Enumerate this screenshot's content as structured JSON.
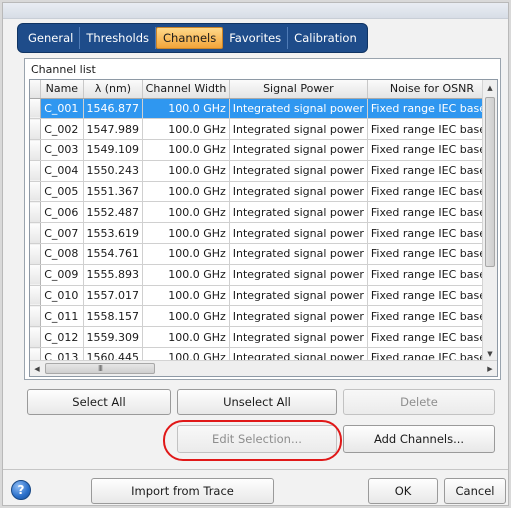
{
  "tabs": [
    {
      "label": "General",
      "active": false
    },
    {
      "label": "Thresholds",
      "active": false
    },
    {
      "label": "Channels",
      "active": true
    },
    {
      "label": "Favorites",
      "active": false
    },
    {
      "label": "Calibration",
      "active": false
    }
  ],
  "channel_list": {
    "title": "Channel list",
    "columns": [
      "",
      "Name",
      "λ (nm)",
      "Channel Width",
      "Signal Power",
      "Noise for OSNR"
    ],
    "selected_row_index": 0,
    "rows": [
      {
        "name": "C_001",
        "wavelength": "1546.877",
        "width": "100.0 GHz",
        "signal_power": "Integrated signal power",
        "noise": "Fixed range IEC based"
      },
      {
        "name": "C_002",
        "wavelength": "1547.989",
        "width": "100.0 GHz",
        "signal_power": "Integrated signal power",
        "noise": "Fixed range IEC based"
      },
      {
        "name": "C_003",
        "wavelength": "1549.109",
        "width": "100.0 GHz",
        "signal_power": "Integrated signal power",
        "noise": "Fixed range IEC based"
      },
      {
        "name": "C_004",
        "wavelength": "1550.243",
        "width": "100.0 GHz",
        "signal_power": "Integrated signal power",
        "noise": "Fixed range IEC based"
      },
      {
        "name": "C_005",
        "wavelength": "1551.367",
        "width": "100.0 GHz",
        "signal_power": "Integrated signal power",
        "noise": "Fixed range IEC based"
      },
      {
        "name": "C_006",
        "wavelength": "1552.487",
        "width": "100.0 GHz",
        "signal_power": "Integrated signal power",
        "noise": "Fixed range IEC based"
      },
      {
        "name": "C_007",
        "wavelength": "1553.619",
        "width": "100.0 GHz",
        "signal_power": "Integrated signal power",
        "noise": "Fixed range IEC based"
      },
      {
        "name": "C_008",
        "wavelength": "1554.761",
        "width": "100.0 GHz",
        "signal_power": "Integrated signal power",
        "noise": "Fixed range IEC based"
      },
      {
        "name": "C_009",
        "wavelength": "1555.893",
        "width": "100.0 GHz",
        "signal_power": "Integrated signal power",
        "noise": "Fixed range IEC based"
      },
      {
        "name": "C_010",
        "wavelength": "1557.017",
        "width": "100.0 GHz",
        "signal_power": "Integrated signal power",
        "noise": "Fixed range IEC based"
      },
      {
        "name": "C_011",
        "wavelength": "1558.157",
        "width": "100.0 GHz",
        "signal_power": "Integrated signal power",
        "noise": "Fixed range IEC based"
      },
      {
        "name": "C_012",
        "wavelength": "1559.309",
        "width": "100.0 GHz",
        "signal_power": "Integrated signal power",
        "noise": "Fixed range IEC based"
      },
      {
        "name": "C_013",
        "wavelength": "1560.445",
        "width": "100.0 GHz",
        "signal_power": "Integrated signal power",
        "noise": "Fixed range IEC based"
      }
    ],
    "hscroll_grip": "III"
  },
  "buttons": {
    "select_all": "Select All",
    "unselect_all": "Unselect All",
    "delete": "Delete",
    "edit_selection": "Edit Selection...",
    "add_channels": "Add Channels...",
    "import_from_trace": "Import from Trace",
    "ok": "OK",
    "cancel": "Cancel",
    "help": "?"
  },
  "colors": {
    "selection": "#2f97f0",
    "tab_bar": "#1e4c8a",
    "active_tab": "#f2a43a",
    "highlight_ring": "#e01818"
  }
}
